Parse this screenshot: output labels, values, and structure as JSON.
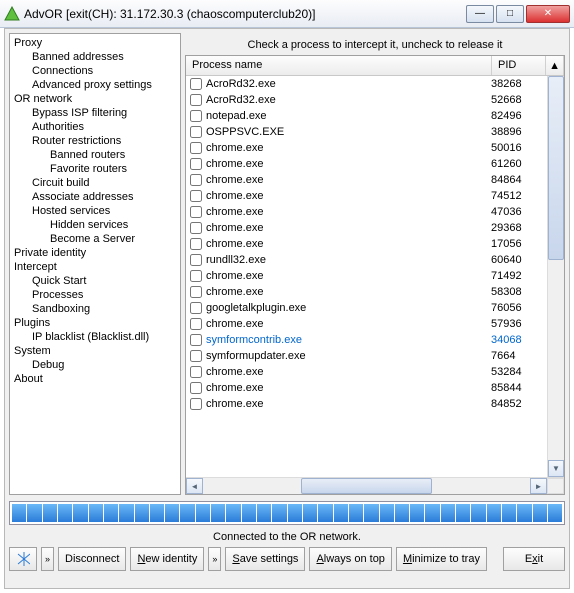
{
  "window": {
    "title": "AdvOR [exit(CH): 31.172.30.3 (chaoscomputerclub20)]"
  },
  "tree": [
    {
      "label": "Proxy",
      "depth": 0
    },
    {
      "label": "Banned addresses",
      "depth": 1
    },
    {
      "label": "Connections",
      "depth": 1
    },
    {
      "label": "Advanced proxy settings",
      "depth": 1
    },
    {
      "label": "OR network",
      "depth": 0
    },
    {
      "label": "Bypass ISP filtering",
      "depth": 1
    },
    {
      "label": "Authorities",
      "depth": 1
    },
    {
      "label": "Router restrictions",
      "depth": 1
    },
    {
      "label": "Banned routers",
      "depth": 2
    },
    {
      "label": "Favorite routers",
      "depth": 2
    },
    {
      "label": "Circuit build",
      "depth": 1
    },
    {
      "label": "Associate addresses",
      "depth": 1
    },
    {
      "label": "Hosted services",
      "depth": 1
    },
    {
      "label": "Hidden services",
      "depth": 2
    },
    {
      "label": "Become a Server",
      "depth": 2
    },
    {
      "label": "Private identity",
      "depth": 0
    },
    {
      "label": "Intercept",
      "depth": 0
    },
    {
      "label": "Quick Start",
      "depth": 1
    },
    {
      "label": "Processes",
      "depth": 1
    },
    {
      "label": "Sandboxing",
      "depth": 1
    },
    {
      "label": "Plugins",
      "depth": 0
    },
    {
      "label": "IP blacklist (Blacklist.dll)",
      "depth": 1
    },
    {
      "label": "System",
      "depth": 0
    },
    {
      "label": "Debug",
      "depth": 1
    },
    {
      "label": "About",
      "depth": 0
    }
  ],
  "hint": "Check a process to intercept it, uncheck to release it",
  "columns": {
    "name": "Process name",
    "pid": "PID"
  },
  "processes": [
    {
      "name": "AcroRd32.exe",
      "pid": "38268",
      "hl": false
    },
    {
      "name": "AcroRd32.exe",
      "pid": "52668",
      "hl": false
    },
    {
      "name": "notepad.exe",
      "pid": "82496",
      "hl": false
    },
    {
      "name": "OSPPSVC.EXE",
      "pid": "38896",
      "hl": false
    },
    {
      "name": "chrome.exe",
      "pid": "50016",
      "hl": false
    },
    {
      "name": "chrome.exe",
      "pid": "61260",
      "hl": false
    },
    {
      "name": "chrome.exe",
      "pid": "84864",
      "hl": false
    },
    {
      "name": "chrome.exe",
      "pid": "74512",
      "hl": false
    },
    {
      "name": "chrome.exe",
      "pid": "47036",
      "hl": false
    },
    {
      "name": "chrome.exe",
      "pid": "29368",
      "hl": false
    },
    {
      "name": "chrome.exe",
      "pid": "17056",
      "hl": false
    },
    {
      "name": "rundll32.exe",
      "pid": "60640",
      "hl": false
    },
    {
      "name": "chrome.exe",
      "pid": "71492",
      "hl": false
    },
    {
      "name": "chrome.exe",
      "pid": "58308",
      "hl": false
    },
    {
      "name": "googletalkplugin.exe",
      "pid": "76056",
      "hl": false
    },
    {
      "name": "chrome.exe",
      "pid": "57936",
      "hl": false
    },
    {
      "name": "symformcontrib.exe",
      "pid": "34068",
      "hl": true
    },
    {
      "name": "symformupdater.exe",
      "pid": "7664",
      "hl": false
    },
    {
      "name": "chrome.exe",
      "pid": "53284",
      "hl": false
    },
    {
      "name": "chrome.exe",
      "pid": "85844",
      "hl": false
    },
    {
      "name": "chrome.exe",
      "pid": "84852",
      "hl": false
    }
  ],
  "status": "Connected to the OR network.",
  "buttons": {
    "disconnect": "Disconnect",
    "newidentity": "New identity",
    "save": "Save settings",
    "ontop": "Always on top",
    "minimize": "Minimize to tray",
    "exit": "Exit"
  },
  "progress_segments": 36
}
